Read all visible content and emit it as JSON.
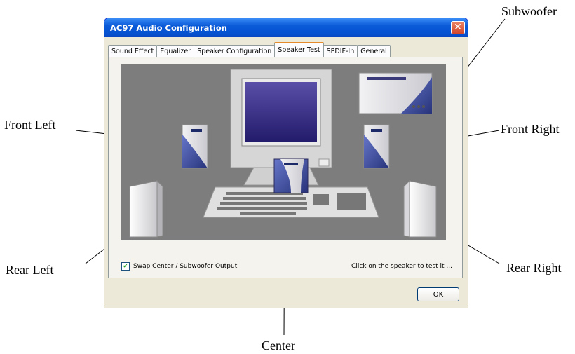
{
  "window": {
    "title": "AC97 Audio Configuration"
  },
  "tabs": [
    {
      "label": "Sound Effect",
      "active": false
    },
    {
      "label": "Equalizer",
      "active": false
    },
    {
      "label": "Speaker Configuration",
      "active": false
    },
    {
      "label": "Speaker Test",
      "active": true
    },
    {
      "label": "SPDIF-In",
      "active": false
    },
    {
      "label": "General",
      "active": false
    }
  ],
  "options": {
    "swap_label": "Swap Center / Subwoofer Output",
    "swap_checked": true
  },
  "hint": "Click on the speaker to test it ...",
  "buttons": {
    "ok": "OK"
  },
  "callouts": {
    "subwoofer": "Subwoofer",
    "front_left": "Front Left",
    "front_right": "Front Right",
    "rear_left": "Rear Left",
    "rear_right": "Rear Right",
    "center": "Center"
  },
  "colors": {
    "titlebar": "#0a5ad8",
    "stage": "#7d7d7d",
    "speaker_blue": "#3e4fa3"
  }
}
